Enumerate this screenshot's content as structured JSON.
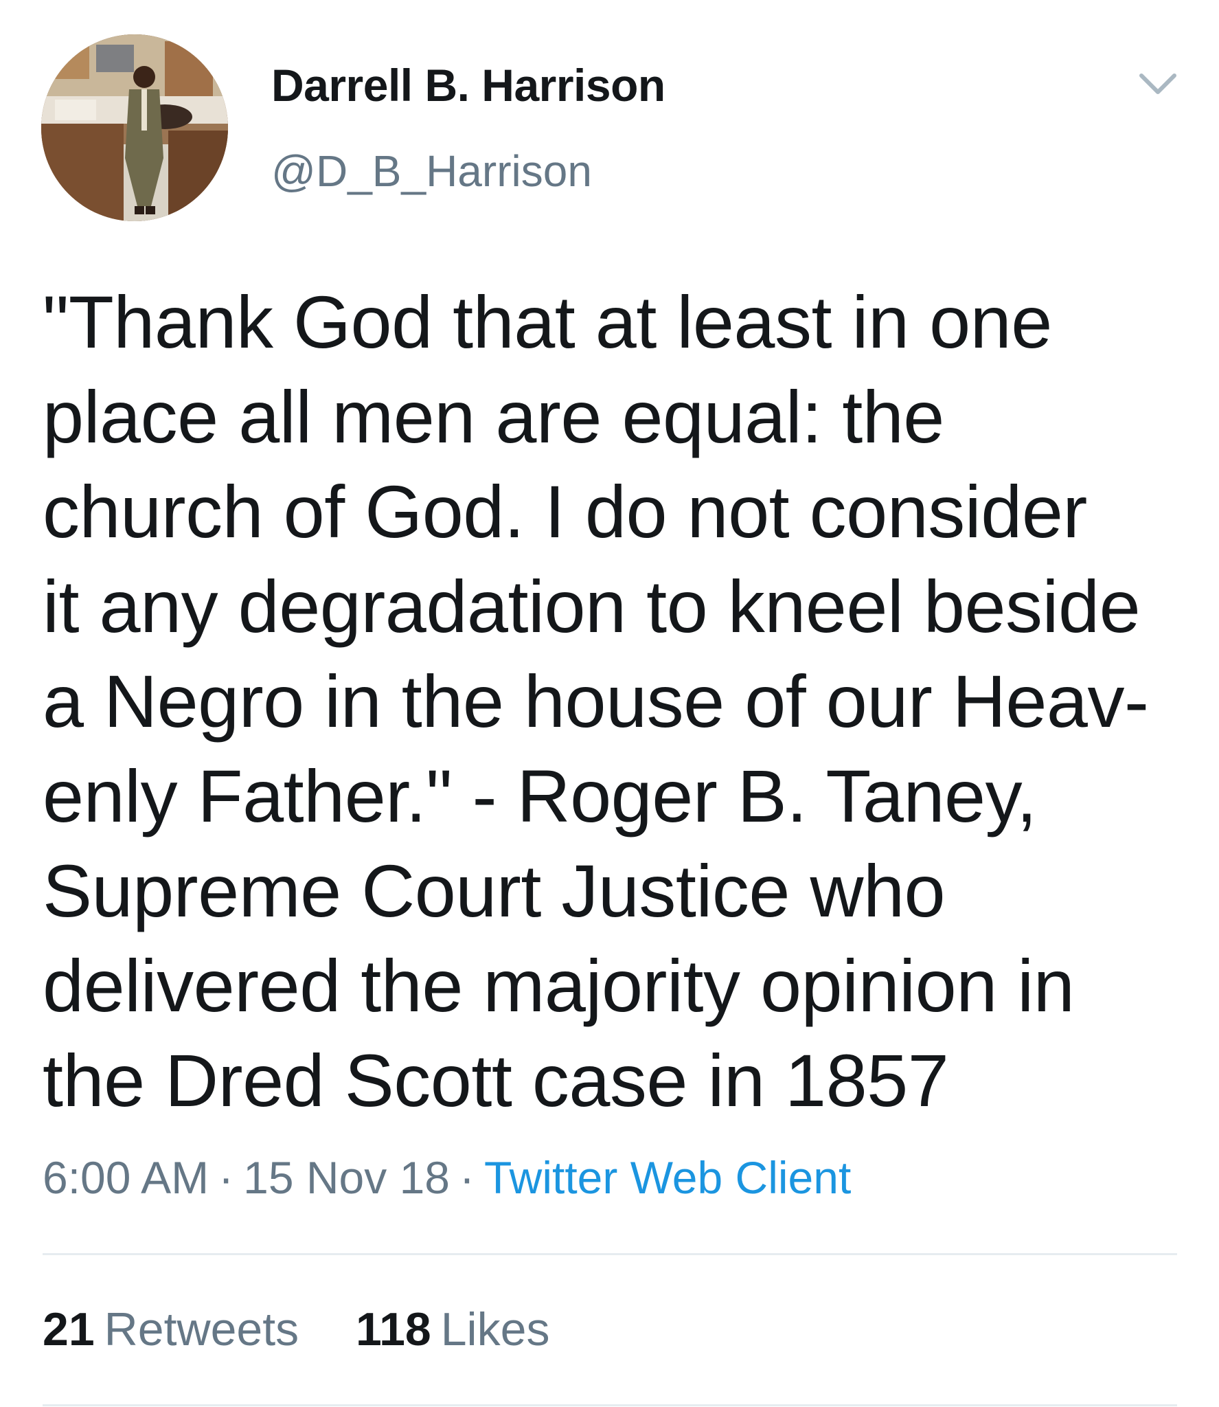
{
  "author": {
    "display_name": "Darrell B. Harrison",
    "handle": "@D_B_Harrison",
    "avatar_icon": "user-avatar-photo"
  },
  "caret_icon": "chevron-down-icon",
  "tweet": {
    "text_lines": [
      "\"Thank God that at least in one",
      "place all men are equal: the",
      "church of God. I do not consider",
      "it any degradation to kneel beside",
      "a Negro in the house of our Heav-",
      "enly Father.\" - Roger B. Taney,",
      "Supreme Court Justice who",
      "delivered the majority opinion in",
      "the Dred Scott case in 1857"
    ]
  },
  "meta": {
    "time": "6:00 AM",
    "date": "15 Nov 18",
    "source": "Twitter Web Client",
    "separator": "·"
  },
  "stats": {
    "retweets_count": "21",
    "retweets_label": "Retweets",
    "likes_count": "118",
    "likes_label": "Likes"
  },
  "colors": {
    "text": "#14171a",
    "secondary": "#657786",
    "link": "#1b95e0",
    "divider": "#e6ecf0"
  }
}
